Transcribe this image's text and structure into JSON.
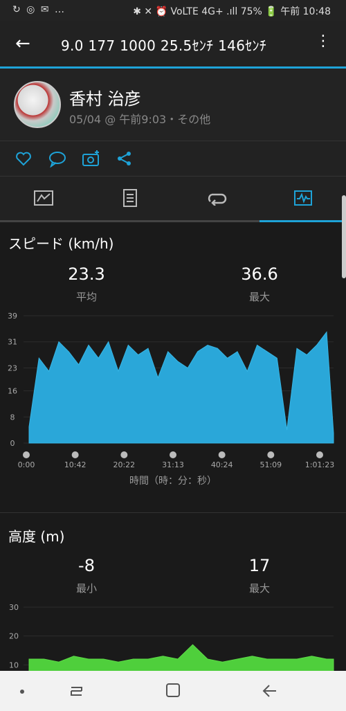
{
  "status_bar": {
    "left": "↻ ◎ ✉ …",
    "right": "✱ ✕ ⏰ VoLTE 4G+ .ıll 75% 🔋 午前 10:48"
  },
  "app_bar": {
    "back_icon": "arrow-left-icon",
    "title": "9.0  177  1000  25.5ｾﾝﾁ  146ｾﾝﾁ",
    "menu_icon": "more-vert-icon"
  },
  "profile": {
    "name": "香村 治彦",
    "meta": "05/04 @ 午前9:03・その他"
  },
  "actions": [
    {
      "icon": "heart-icon",
      "glyph": "♡"
    },
    {
      "icon": "comment-icon",
      "glyph": "💬"
    },
    {
      "icon": "add-photo-icon",
      "glyph": "📷"
    },
    {
      "icon": "share-icon",
      "glyph": "⋖"
    }
  ],
  "tabs": [
    {
      "icon": "summary-icon",
      "glyph": "▣"
    },
    {
      "icon": "details-icon",
      "glyph": "▤"
    },
    {
      "icon": "laps-icon",
      "glyph": "⟲"
    },
    {
      "icon": "charts-icon",
      "glyph": "◩"
    }
  ],
  "colors": {
    "accent": "#1ea3d8",
    "speed_fill": "#2aa7d9",
    "altitude_fill": "#4fcf3c"
  },
  "speed": {
    "title": "スピード (km/h)",
    "avg_value": "23.3",
    "avg_label": "平均",
    "max_value": "36.6",
    "max_label": "最大",
    "x_axis_label": "時間（時：分：秒）"
  },
  "altitude": {
    "title": "高度 (m)",
    "min_value": "-8",
    "min_label": "最小",
    "max_value": "17",
    "max_label": "最大"
  },
  "chart_data": [
    {
      "type": "area",
      "title": "スピード (km/h)",
      "xlabel": "時間（時：分：秒）",
      "ylabel": "",
      "y_ticks": [
        "0",
        "8",
        "16",
        "23",
        "31",
        "39"
      ],
      "ylim": [
        0,
        39
      ],
      "x_ticks": [
        "0:00",
        "10:42",
        "20:22",
        "31:13",
        "40:24",
        "51:09",
        "1:01:23"
      ],
      "x_minutes": [
        0,
        2,
        4,
        6,
        8,
        10,
        12,
        14,
        16,
        18,
        20,
        22,
        24,
        26,
        28,
        30,
        32,
        34,
        36,
        38,
        40,
        42,
        44,
        46,
        48,
        50,
        52,
        54,
        56,
        58,
        60,
        61.4
      ],
      "values": [
        5,
        26,
        22,
        31,
        28,
        24,
        30,
        26,
        31,
        22,
        30,
        27,
        29,
        20,
        28,
        25,
        23,
        28,
        30,
        29,
        26,
        28,
        22,
        30,
        28,
        26,
        4,
        29,
        27,
        30,
        34,
        3
      ],
      "grid": true
    },
    {
      "type": "area",
      "title": "高度 (m)",
      "xlabel": "",
      "ylabel": "",
      "y_ticks": [
        "10",
        "20",
        "30"
      ],
      "ylim": [
        0,
        30
      ],
      "x_minutes": [
        0,
        3,
        6,
        9,
        12,
        15,
        18,
        21,
        24,
        27,
        30,
        33,
        36,
        39,
        42,
        45,
        48,
        51,
        54,
        57,
        60,
        61.4
      ],
      "values": [
        12,
        12,
        11,
        13,
        12,
        12,
        11,
        12,
        12,
        13,
        12,
        17,
        12,
        11,
        12,
        13,
        12,
        12,
        12,
        13,
        12,
        12
      ],
      "grid": true
    }
  ]
}
